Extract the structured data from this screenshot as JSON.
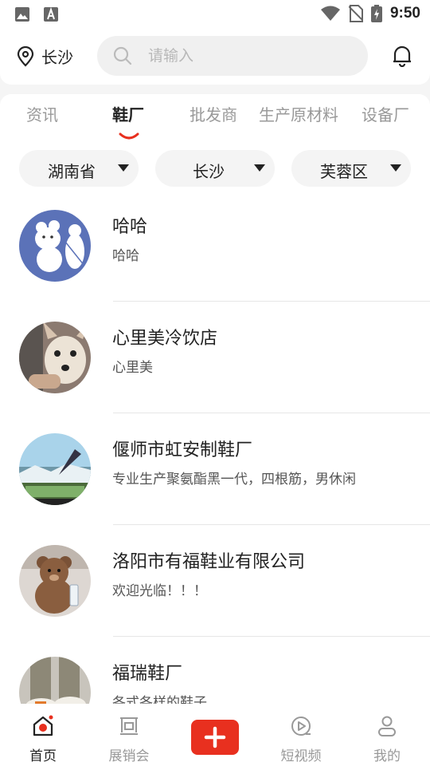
{
  "status_bar": {
    "time": "9:50",
    "icons": [
      "gallery-icon",
      "keyboard-icon",
      "wifi-icon",
      "no-sim-icon",
      "battery-icon"
    ]
  },
  "header": {
    "location": "长沙",
    "search_placeholder": "请输入"
  },
  "tabs": [
    {
      "label": "资讯",
      "active": false
    },
    {
      "label": "鞋厂",
      "active": true
    },
    {
      "label": "批发商",
      "active": false
    },
    {
      "label": "生产原材料",
      "active": false
    },
    {
      "label": "设备厂",
      "active": false
    }
  ],
  "filters": [
    {
      "label": "湖南省"
    },
    {
      "label": "长沙"
    },
    {
      "label": "芙蓉区"
    }
  ],
  "list": [
    {
      "title": "哈哈",
      "subtitle": "哈哈",
      "avatar": "cartoon-bears"
    },
    {
      "title": "心里美冷饮店",
      "subtitle": "心里美",
      "avatar": "dog-photo"
    },
    {
      "title": "偃师市虹安制鞋厂",
      "subtitle": "专业生产聚氨酯黑一代，四根筋，男休闲",
      "avatar": "landscape-photo"
    },
    {
      "title": "洛阳市有福鞋业有限公司",
      "subtitle": "欢迎光临！！！",
      "avatar": "teddy-bear-photo"
    },
    {
      "title": "福瑞鞋厂",
      "subtitle": "各式各样的鞋子",
      "avatar": "sneakers-photo"
    }
  ],
  "bottom_nav": [
    {
      "label": "首页",
      "icon": "home-icon",
      "active": true
    },
    {
      "label": "展销会",
      "icon": "exhibition-icon",
      "active": false
    },
    {
      "label": "",
      "icon": "plus-icon",
      "active": false
    },
    {
      "label": "短视频",
      "icon": "video-icon",
      "active": false
    },
    {
      "label": "我的",
      "icon": "profile-icon",
      "active": false
    }
  ],
  "colors": {
    "accent": "#e8301f",
    "active_text": "#222222",
    "inactive_text": "#999999"
  }
}
